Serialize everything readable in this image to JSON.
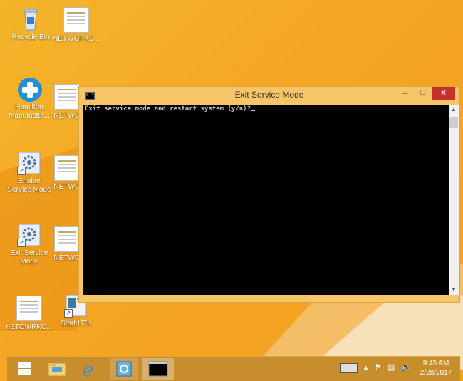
{
  "desktop": {
    "icons": [
      {
        "label": "Recycle Bin"
      },
      {
        "label": "NETWORKC..."
      },
      {
        "label": "Hamilton Manufactur..."
      },
      {
        "label": "NETWO"
      },
      {
        "label": "Enable Service Mode"
      },
      {
        "label": "NETWO"
      },
      {
        "label": "Exit Service Mode"
      },
      {
        "label": "NETWO"
      },
      {
        "label": "nETOWRKC..."
      },
      {
        "label": "Start HTK"
      }
    ]
  },
  "window": {
    "title": "Exit Service Mode",
    "icon_text": "C:\\.",
    "minimize": "–",
    "maximize": "□",
    "close": "×",
    "console_text": "Exit service mode and restart system (y/n)?"
  },
  "taskbar": {
    "items": [
      "windows-start",
      "file-explorer",
      "internet-explorer",
      "control-panel-app",
      "command-prompt"
    ],
    "cmd_icon_text": "C:\\_",
    "time": "9:45 AM",
    "date": "2/28/2017"
  },
  "colors": {
    "desktop": "#f5a623",
    "close_button": "#c7312b",
    "console_bg": "#000000",
    "window_frame": "#f5c568"
  }
}
